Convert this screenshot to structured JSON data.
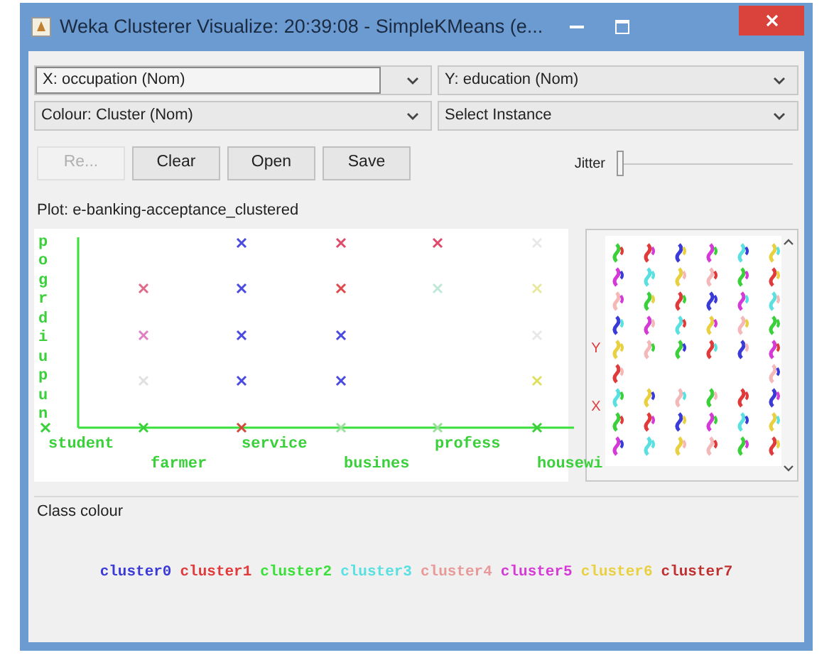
{
  "window": {
    "title": "Weka Clusterer Visualize: 20:39:08 - SimpleKMeans (e..."
  },
  "selectors": [
    {
      "label": "X: occupation (Nom)",
      "selected": true
    },
    {
      "label": "Y: education (Nom)",
      "selected": false
    },
    {
      "label": "Colour: Cluster (Nom)",
      "selected": false
    },
    {
      "label": "Select Instance",
      "selected": false
    }
  ],
  "buttons": [
    {
      "label": "Re...",
      "disabled": true
    },
    {
      "label": "Clear",
      "disabled": false
    },
    {
      "label": "Open",
      "disabled": false
    },
    {
      "label": "Save",
      "disabled": false
    }
  ],
  "jitter": {
    "label": "Jitter",
    "level": 0
  },
  "plot": {
    "title": "Plot: e-banking-acceptance_clustered",
    "y_labels": [
      "p",
      "o",
      "g",
      "r",
      "d",
      "i",
      "u",
      "p",
      "u",
      "n"
    ],
    "x_labels": [
      "student",
      "farmer",
      "service",
      "busines",
      "profess",
      "housewi"
    ]
  },
  "matrix": {
    "y_label": "Y",
    "x_label": "X"
  },
  "class_colour": {
    "title": "Class colour",
    "clusters": [
      {
        "name": "cluster0",
        "color": "#3a3ad8"
      },
      {
        "name": "cluster1",
        "color": "#e03a3a"
      },
      {
        "name": "cluster2",
        "color": "#3ae03a"
      },
      {
        "name": "cluster3",
        "color": "#5ae0e0"
      },
      {
        "name": "cluster4",
        "color": "#e89a9a"
      },
      {
        "name": "cluster5",
        "color": "#d63ad6"
      },
      {
        "name": "cluster6",
        "color": "#e8d040"
      },
      {
        "name": "cluster7",
        "color": "#c03030"
      }
    ]
  }
}
